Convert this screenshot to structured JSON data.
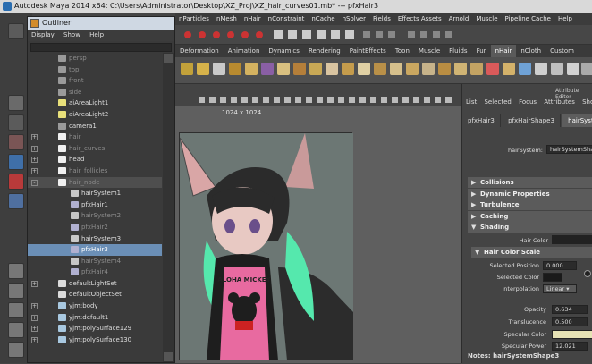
{
  "window": {
    "title": "Autodesk Maya 2014 x64: C:\\Users\\Administrator\\Desktop\\XZ_Proj\\XZ_hair_curves01.mb*   ---   pfxHair3"
  },
  "menubar": [
    "nParticles",
    "nMesh",
    "nHair",
    "nConstraint",
    "nCache",
    "nSolver",
    "Fields",
    "Effects Assets",
    "Arnold",
    "Muscle",
    "Pipeline Cache",
    "Help"
  ],
  "shelf_tabs": [
    "Deformation",
    "Animation",
    "Dynamics",
    "Rendering",
    "PaintEffects",
    "Toon",
    "Muscle",
    "Fluids",
    "Fur",
    "nHair",
    "nCloth",
    "Custom"
  ],
  "shelf_active": "nHair",
  "outliner": {
    "title": "Outliner",
    "menu": [
      "Display",
      "Show",
      "Help"
    ],
    "items": [
      {
        "label": "persp",
        "indent": 1,
        "dim": true,
        "icon": "camera-icon",
        "expander": false
      },
      {
        "label": "top",
        "indent": 1,
        "dim": true,
        "icon": "camera-icon",
        "expander": false
      },
      {
        "label": "front",
        "indent": 1,
        "dim": true,
        "icon": "camera-icon",
        "expander": false
      },
      {
        "label": "side",
        "indent": 1,
        "dim": true,
        "icon": "camera-icon",
        "expander": false
      },
      {
        "label": "aiAreaLight1",
        "indent": 1,
        "dim": false,
        "icon": "light-icon",
        "expander": false
      },
      {
        "label": "aiAreaLight2",
        "indent": 1,
        "dim": false,
        "icon": "light-icon",
        "expander": false
      },
      {
        "label": "camera1",
        "indent": 1,
        "dim": false,
        "icon": "camera-icon",
        "expander": false
      },
      {
        "label": "hair",
        "indent": 1,
        "dim": true,
        "icon": "group-icon",
        "expander": "+"
      },
      {
        "label": "hair_curves",
        "indent": 1,
        "dim": true,
        "icon": "group-icon",
        "expander": "+"
      },
      {
        "label": "head",
        "indent": 1,
        "dim": false,
        "icon": "group-icon",
        "expander": "+"
      },
      {
        "label": "hair_follicles",
        "indent": 1,
        "dim": true,
        "icon": "group-icon",
        "expander": "+"
      },
      {
        "label": "hair_node",
        "indent": 1,
        "dim": true,
        "icon": "group-icon",
        "expander": "-",
        "highlight": true
      },
      {
        "label": "hairSystem1",
        "indent": 2,
        "dim": false,
        "icon": "hair-system-icon",
        "expander": false
      },
      {
        "label": "pfxHair1",
        "indent": 2,
        "dim": false,
        "icon": "pfx-hair-icon",
        "expander": false
      },
      {
        "label": "hairSystem2",
        "indent": 2,
        "dim": true,
        "icon": "hair-system-icon",
        "expander": false
      },
      {
        "label": "pfxHair2",
        "indent": 2,
        "dim": true,
        "icon": "pfx-hair-icon",
        "expander": false
      },
      {
        "label": "hairSystem3",
        "indent": 2,
        "dim": false,
        "icon": "hair-system-icon",
        "expander": false
      },
      {
        "label": "pfxHair3",
        "indent": 2,
        "dim": false,
        "icon": "pfx-hair-icon",
        "expander": false,
        "selected": true
      },
      {
        "label": "hairSystem4",
        "indent": 2,
        "dim": true,
        "icon": "hair-system-icon",
        "expander": false
      },
      {
        "label": "pfxHair4",
        "indent": 2,
        "dim": true,
        "icon": "pfx-hair-icon",
        "expander": false
      },
      {
        "label": "defaultLightSet",
        "indent": 1,
        "dim": false,
        "icon": "set-icon",
        "expander": "+"
      },
      {
        "label": "defaultObjectSet",
        "indent": 1,
        "dim": false,
        "icon": "set-icon",
        "expander": false
      },
      {
        "label": "yjm:body",
        "indent": 1,
        "dim": false,
        "icon": "mesh-icon",
        "expander": "+"
      },
      {
        "label": "yjm:default1",
        "indent": 1,
        "dim": false,
        "icon": "mesh-icon",
        "expander": "+"
      },
      {
        "label": "yjm:polySurface129",
        "indent": 1,
        "dim": false,
        "icon": "mesh-icon",
        "expander": "+"
      },
      {
        "label": "yjm:polySurface130",
        "indent": 1,
        "dim": false,
        "icon": "mesh-icon",
        "expander": "+"
      }
    ]
  },
  "viewport": {
    "resolution_label": "1024 x 1024",
    "shirt_text": "ALOHA MICKEY"
  },
  "attribute_editor": {
    "title": "Attribute Editor",
    "menu": [
      "List",
      "Selected",
      "Focus",
      "Attributes",
      "Show"
    ],
    "tabs": [
      "pfxHair3",
      "pfxHairShape3",
      "hairSystemS"
    ],
    "active_tab": "hairSystemS",
    "node_label": "hairSystem:",
    "node_value": "hairSystemShap",
    "sections": [
      {
        "label": "Collisions",
        "open": false
      },
      {
        "label": "Dynamic Properties",
        "open": false
      },
      {
        "label": "Turbulence",
        "open": false
      },
      {
        "label": "Caching",
        "open": false
      },
      {
        "label": "Shading",
        "open": true
      }
    ],
    "hair_color_label": "Hair Color",
    "subsection": "Hair Color Scale",
    "selected_position_label": "Selected Position",
    "selected_position_value": "0.000",
    "selected_color_label": "Selected Color",
    "interpolation_label": "Interpolation",
    "interpolation_value": "Linear",
    "opacity_label": "Opacity",
    "opacity_value": "0.634",
    "translucence_label": "Translucence",
    "translucence_value": "0.500",
    "specular_color_label": "Specular Color",
    "specular_power_label": "Specular Power",
    "specular_power_value": "12.021",
    "notes_label": "Notes: hairSystemShape3"
  },
  "colors": {
    "selection": "#6b8fb6",
    "hair_green": "#55e8ad",
    "shirt_pink": "#e86aa0"
  }
}
